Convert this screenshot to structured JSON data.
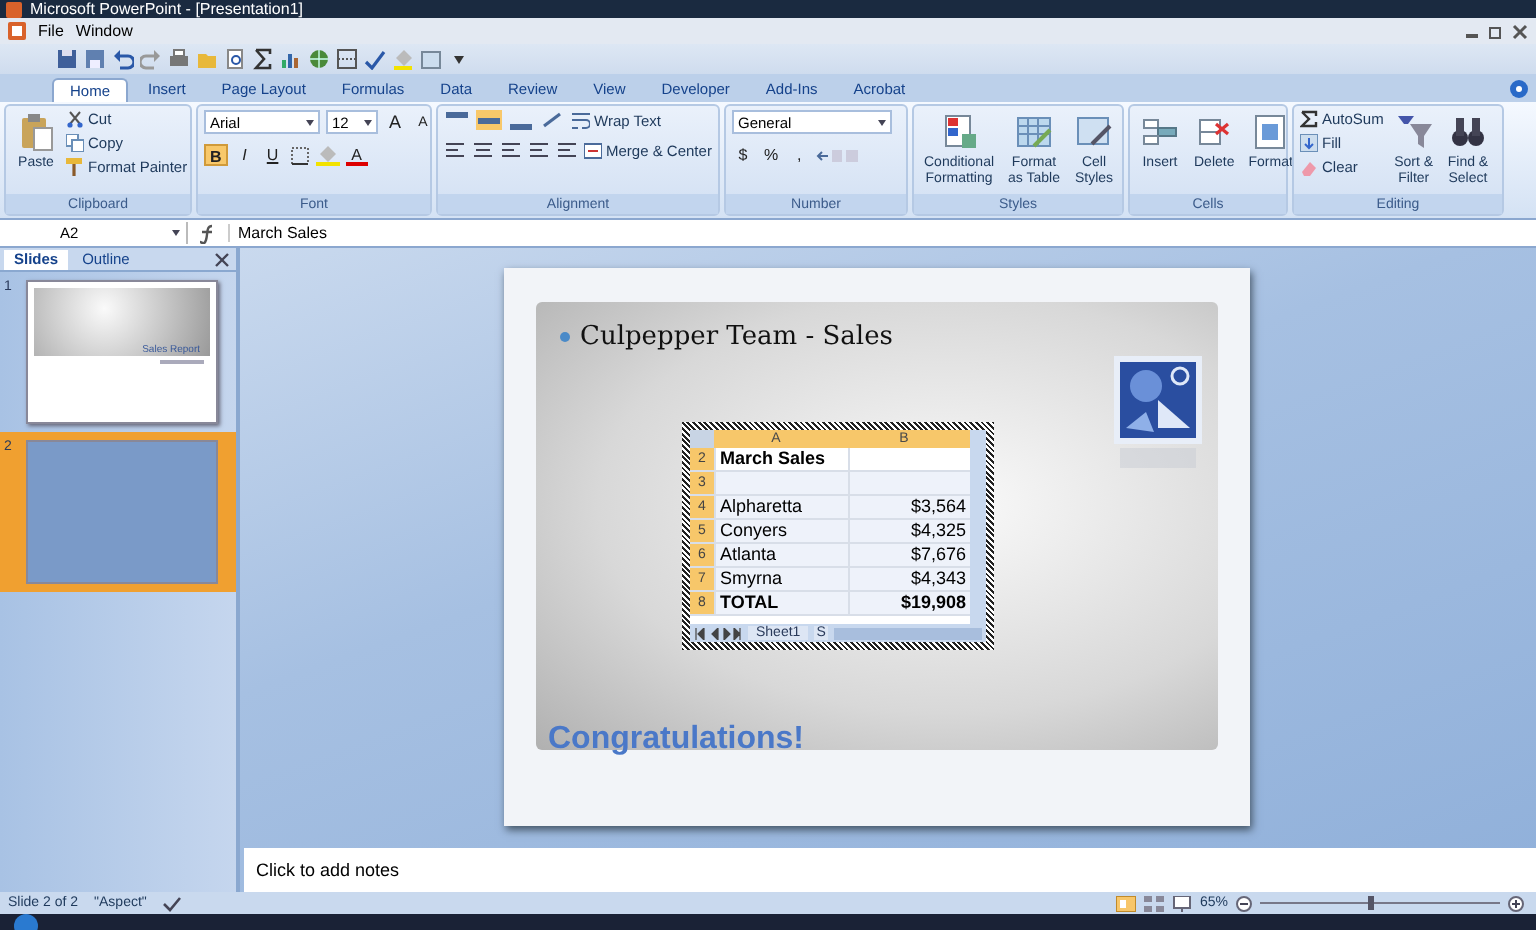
{
  "window": {
    "title": "Microsoft PowerPoint - [Presentation1]"
  },
  "menu": [
    {
      "label": "File"
    },
    {
      "label": "Window"
    }
  ],
  "ribbon": {
    "tabs": [
      {
        "label": "Home",
        "selected": true
      },
      {
        "label": "Insert",
        "selected": false
      },
      {
        "label": "Page Layout",
        "selected": false
      },
      {
        "label": "Formulas",
        "selected": false
      },
      {
        "label": "Data",
        "selected": false
      },
      {
        "label": "Review",
        "selected": false
      },
      {
        "label": "View",
        "selected": false
      },
      {
        "label": "Developer",
        "selected": false
      },
      {
        "label": "Add-Ins",
        "selected": false
      },
      {
        "label": "Acrobat",
        "selected": false
      }
    ],
    "groups": [
      {
        "kind": "clipboard",
        "title": "Clipboard",
        "buttons": [
          {
            "label": "Paste"
          },
          {
            "label": "Cut"
          },
          {
            "label": "Copy"
          },
          {
            "label": "Format Painter"
          }
        ]
      },
      {
        "kind": "font",
        "title": "Font",
        "font": "Arial",
        "size": "12",
        "size_buttons": [
          "A",
          "A"
        ],
        "styles": [
          {
            "label": "B",
            "on": true
          },
          {
            "label": "I",
            "on": false
          },
          {
            "label": "U",
            "on": false
          }
        ],
        "color_button": "A"
      },
      {
        "kind": "alignment",
        "title": "Alignment",
        "valign": [
          {
            "selected": false
          },
          {
            "selected": true
          },
          {
            "selected": false
          }
        ],
        "buttons": [
          {
            "label": "Wrap Text"
          },
          {
            "label": "Merge & Center"
          }
        ]
      },
      {
        "kind": "number",
        "title": "Number",
        "format": "General",
        "buttons": [
          {
            "label": "$"
          },
          {
            "label": "%"
          },
          {
            "label": ","
          }
        ]
      },
      {
        "kind": "large",
        "title": "Styles",
        "buttons": [
          {
            "label": "Conditional\nFormatting"
          },
          {
            "label": "Format\nas Table"
          },
          {
            "label": "Cell\nStyles"
          }
        ]
      },
      {
        "kind": "large",
        "title": "Cells",
        "buttons": [
          {
            "label": "Insert"
          },
          {
            "label": "Delete"
          },
          {
            "label": "Format"
          }
        ]
      },
      {
        "kind": "editing",
        "title": "Editing",
        "small": [
          {
            "label": "AutoSum"
          },
          {
            "label": "Fill"
          },
          {
            "label": "Clear"
          }
        ],
        "buttons": [
          {
            "label": "Sort &\nFilter"
          },
          {
            "label": "Find &\nSelect"
          }
        ]
      }
    ]
  },
  "formula_bar": {
    "name_box": "A2",
    "formula": "March Sales"
  },
  "slides_pane": {
    "tabs": [
      {
        "label": "Slides",
        "selected": true
      },
      {
        "label": "Outline",
        "selected": false
      }
    ],
    "thumbnails": [
      {
        "number": "1",
        "title": "Sales Report",
        "selected": false
      },
      {
        "number": "2",
        "selected": true
      }
    ]
  },
  "slide": {
    "bullet": "Culpepper Team - Sales",
    "footer": "Congratulations!",
    "spreadsheet": {
      "columns": [
        "A",
        "B"
      ],
      "rows": [
        {
          "number": "2",
          "cells": [
            "March Sales",
            ""
          ],
          "bold": true
        },
        {
          "number": "3",
          "cells": [
            "",
            ""
          ]
        },
        {
          "number": "4",
          "cells": [
            "Alpharetta",
            "$3,564"
          ],
          "bold": false
        },
        {
          "number": "5",
          "cells": [
            "Conyers",
            "$4,325"
          ],
          "bold": false
        },
        {
          "number": "6",
          "cells": [
            "Atlanta",
            "$7,676"
          ],
          "bold": false
        },
        {
          "number": "7",
          "cells": [
            "Smyrna",
            "$4,343"
          ],
          "bold": false
        },
        {
          "number": "8",
          "cells": [
            "TOTAL",
            "$19,908"
          ],
          "bold": true
        }
      ],
      "sheet_tabs": [
        "Sheet1",
        "S"
      ]
    }
  },
  "notes": {
    "placeholder": "Click to add notes"
  },
  "status_bar": {
    "slide": "Slide 2 of 2",
    "theme": "\"Aspect\"",
    "zoom": "65%",
    "zoom_slider": {
      "level": 0.45
    }
  }
}
